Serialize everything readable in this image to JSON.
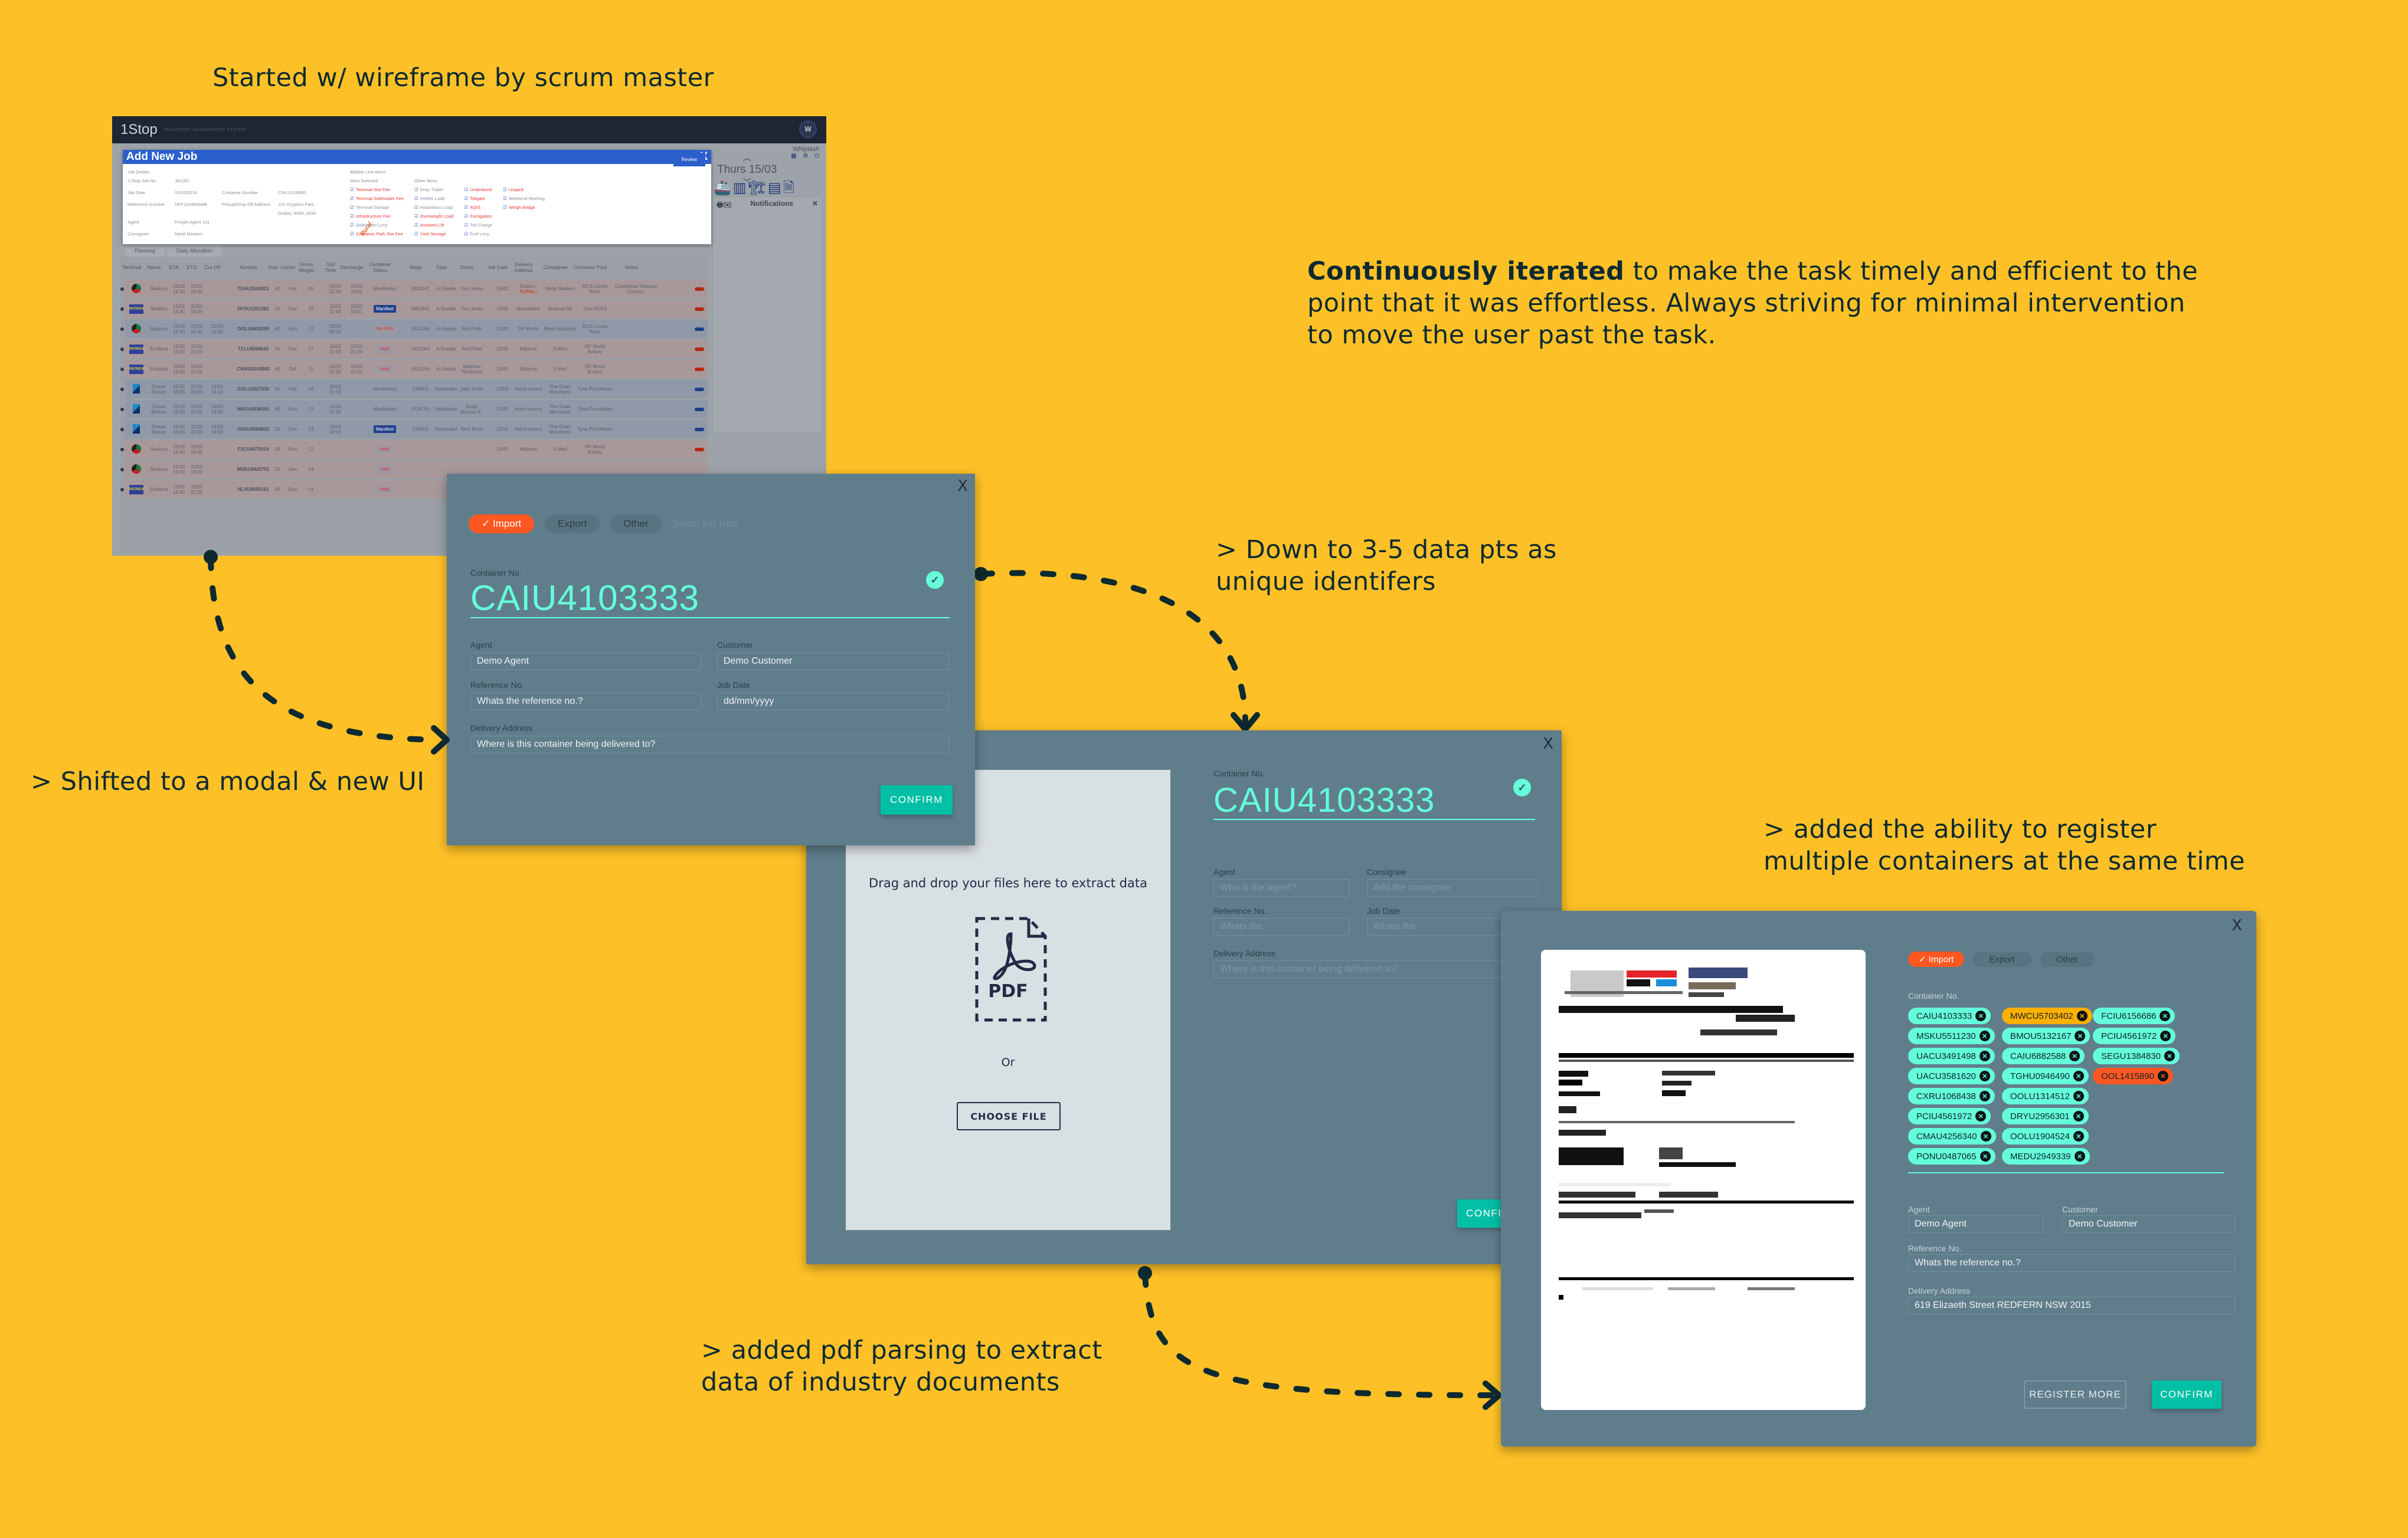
{
  "annotations": {
    "wireframe_caption": "Started w/ wireframe by scrum master",
    "iterated_bold": "Continuously iterated",
    "iterated_rest_1": " to make the task timely and efficient to the",
    "iterated_rest_2": "point that it was effortless. Always striving for minimal intervention",
    "iterated_rest_3": "to move the user past the task.",
    "modal_caption": "> Shifted to a modal & new UI",
    "data_pts_1": "> Down to 3-5 data pts as",
    "data_pts_2": "unique identifers",
    "pdf_1": "> added pdf parsing to extract",
    "pdf_2": "data of industry documents",
    "multi_1": "> added the ability to register",
    "multi_2": "multiple containers at the same time"
  },
  "wireframe": {
    "app_name": "1Stop",
    "app_subtitle": "TRANSPORT MANAGEMENT SYSTEM",
    "avatar_initial": "W",
    "user_name": "Whiplash",
    "user_icons": "▦ ⚙ ⏻",
    "date": "Thurs 15/03",
    "quick_icons": "🚢▥🏗▤🗎",
    "notifications_title": "Notifications",
    "notifications_icons": "🖶✉",
    "modal": {
      "title": "Add New Job",
      "close": "X",
      "job_details": "Job Details",
      "rows": [
        {
          "label": "1-Stop Job No",
          "value": "JB1001"
        },
        {
          "label": "Job Date",
          "value": "01/05/2018",
          "label2": "Container Number",
          "value2": "CNIU1216890"
        },
        {
          "label": "Reference Number",
          "value": "REF123456ABB",
          "label2": "Pickup/Drop Off Address",
          "value2": "101 Gryphon Park, Dubbo, NSW, 2830"
        },
        {
          "label": "Agent",
          "value": "Freight Agent 101"
        },
        {
          "label": "Consignee",
          "value": "Metal Masters"
        }
      ],
      "rural_stamp": "Rural",
      "billable_title": "Billable Line Items",
      "most_selected_title": "Most Selected",
      "other_items_title": "Other Items",
      "most_selected": [
        {
          "label": "Terminal Slot Fee",
          "red": true
        },
        {
          "label": "Terminal Sideloader Fee",
          "red": true
        },
        {
          "label": "Terminal Storage",
          "red": false
        },
        {
          "label": "Infrastructure Fee",
          "red": true
        },
        {
          "label": "Sideloader Levy",
          "red": false
        },
        {
          "label": "Container Park Slot Fee",
          "red": true
        }
      ],
      "other_col1": [
        {
          "label": "Drop Trailer",
          "red": false
        },
        {
          "label": "Reefer Load",
          "red": false
        },
        {
          "label": "Hazardous Load",
          "red": false
        },
        {
          "label": "Overweight Load",
          "red": true
        },
        {
          "label": "Assisted Lift",
          "red": true
        },
        {
          "label": "Yard Storage",
          "red": true
        }
      ],
      "other_col2": [
        {
          "label": "Underbond",
          "red": true
        },
        {
          "label": "Tailgate",
          "red": true
        },
        {
          "label": "AQIS",
          "red": true
        },
        {
          "label": "Fumigation",
          "red": true
        },
        {
          "label": "Toll Charge",
          "red": false
        },
        {
          "label": "Fuel Levy",
          "red": false
        }
      ],
      "other_col3": [
        {
          "label": "Unpack",
          "red": true
        },
        {
          "label": "Weekend Working",
          "red": false
        },
        {
          "label": "Weigh Bridge",
          "red": true
        }
      ],
      "review_label": "Review"
    },
    "tabs": [
      "Planning",
      "Daily Allocation"
    ],
    "columns": [
      "Terminal",
      "Name",
      "ETA",
      "ETD",
      "Cut Off",
      "Number",
      "Size",
      "Comm",
      "Gross Weight",
      "Slot Time",
      "Discharge",
      "Container Status",
      "Rego",
      "Type",
      "Driver",
      "Job Date",
      "Delivery Address",
      "Consignee",
      "Container Park",
      "Notes"
    ],
    "rows": [
      {
        "tone": "red",
        "terminal": "dp",
        "name": "Seabury",
        "eta": "15/03 14:30",
        "etd": "22/03 18:00",
        "cutoff": "",
        "number": "TGHU3543821",
        "size": "40",
        "comm": "Haz",
        "weight": "25",
        "slot": "15/03 22:00",
        "discharge": "15/03 18:01",
        "status": "Manifested",
        "status_type": "text",
        "rego": "BB10HC",
        "type": "A-Double",
        "driver": "Tom Jones",
        "jobdate": "15/03",
        "delivery": "Dubbo / RURAL!",
        "consignee": "Metal Masters",
        "park": "MCS Cooks River",
        "notes": "Conditional Release! Contact..",
        "pill": "red"
      },
      {
        "tone": "red",
        "terminal": "pat",
        "name": "Seabury",
        "eta": "15/03 14:30",
        "etd": "22/03 18:00",
        "cutoff": "",
        "number": "DFSU1201282",
        "size": "20",
        "comm": "Haz",
        "weight": "25",
        "slot": "15/03 22:00",
        "discharge": "15/03 18:01",
        "status": "Manifest",
        "status_type": "manifest",
        "rego": "BB10HC",
        "type": "A-Double",
        "driver": "Tom Jones",
        "jobdate": "15/03",
        "delivery": "Moorebank",
        "consignee": "Musical Hifi",
        "park": "Tyne ACFS",
        "notes": "",
        "pill": "red"
      },
      {
        "tone": "blue",
        "terminal": "dp",
        "name": "Seabury",
        "eta": "15/03 14:30",
        "etd": "22/03 14:30",
        "cutoff": "22/03 11:00",
        "number": "OOLU6439390",
        "size": "40",
        "comm": "Gen",
        "weight": "12",
        "slot": "22/03 09:00",
        "discharge": "",
        "status": "No PRA",
        "status_type": "held",
        "rego": "HG10AA",
        "type": "A-Double",
        "driver": "Anit Patel",
        "jobdate": "15/03",
        "delivery": "DP World",
        "consignee": "Meat Industries",
        "park": "MCS Cooks River",
        "notes": "",
        "pill": "blue"
      },
      {
        "tone": "red",
        "terminal": "pat",
        "name": "Scotland",
        "eta": "15/03 18:00",
        "etd": "22/03 22:00",
        "cutoff": "",
        "number": "TCLU8068643",
        "size": "40",
        "comm": "Haz",
        "weight": "27",
        "slot": "15/03 21:00",
        "discharge": "15/03 21:04",
        "status": "Held",
        "status_type": "held",
        "rego": "HG10AA",
        "type": "A-Double",
        "driver": "Anit Patel",
        "jobdate": "15/03",
        "delivery": "Milperra",
        "consignee": "S-Mart",
        "park": "DP World Botany",
        "notes": "",
        "pill": "red"
      },
      {
        "tone": "red",
        "terminal": "pat",
        "name": "Scotland",
        "eta": "15/03 18:00",
        "etd": "22/03 22:00",
        "cutoff": "",
        "number": "CMAU0243860",
        "size": "40",
        "comm": "Ref",
        "weight": "11",
        "slot": "15/03 21:00",
        "discharge": "15/03 21:22",
        "status": "Held",
        "status_type": "held",
        "rego": "HG10AA",
        "type": "A-Double",
        "driver": "Matthew Tomlinson",
        "jobdate": "15/03",
        "delivery": "Milperra",
        "consignee": "S-Mart",
        "park": "DP World Botany",
        "notes": "",
        "pill": "red"
      },
      {
        "tone": "blue",
        "terminal": "ob",
        "name": "Ocean Breeze",
        "eta": "15/03 18:00",
        "etd": "22/03 22:00",
        "cutoff": "18/03 14:00",
        "number": "OOLU2927530",
        "size": "40",
        "comm": "Haz",
        "weight": "26",
        "slot": "15/03 21:00",
        "discharge": "",
        "status": "Manifested",
        "status_type": "text",
        "rego": "JJ44FG",
        "type": "Sideloader",
        "driver": "Jake Smith",
        "jobdate": "15/03",
        "delivery": "Hutch-insons",
        "consignee": "The Grain Merchants",
        "park": "Tyne Punchbowl",
        "notes": "",
        "pill": "blue"
      },
      {
        "tone": "blue",
        "terminal": "ob",
        "name": "Ocean Breeze",
        "eta": "15/03 18:00",
        "etd": "22/03 22:00",
        "cutoff": "18/03 14:00",
        "number": "MAEU4036061",
        "size": "40",
        "comm": "Gen",
        "weight": "13",
        "slot": "15/03 21:00",
        "discharge": "",
        "status": "Manifested",
        "status_type": "text",
        "rego": "PO87AS",
        "type": "Sideloader",
        "driver": "Balaji Mannar K..",
        "jobdate": "15/03",
        "delivery": "Hutch-insons",
        "consignee": "The Grain Merchants",
        "park": "Tyne Punchbowl",
        "notes": "",
        "pill": "blue"
      },
      {
        "tone": "blue",
        "terminal": "ob",
        "name": "Ocean Breeze",
        "eta": "15/03 18:00",
        "etd": "22/03 22:00",
        "cutoff": "18/03 14:00",
        "number": "HASU4284832",
        "size": "20",
        "comm": "Gen",
        "weight": "13",
        "slot": "15/03 18:00",
        "discharge": "",
        "status": "Manifest",
        "status_type": "manifest",
        "rego": "JJ44FG",
        "type": "Sideloader",
        "driver": "Kent Rose",
        "jobdate": "15/03",
        "delivery": "Hutch-insons",
        "consignee": "The Grain Merchants",
        "park": "Tyne Punchbowl",
        "notes": "",
        "pill": "blue"
      },
      {
        "tone": "red",
        "terminal": "dp",
        "name": "Seabury",
        "eta": "15/03 14:30",
        "etd": "22/03 18:00",
        "cutoff": "",
        "number": "FSCU6875014",
        "size": "20",
        "comm": "Gen",
        "weight": "12",
        "slot": "",
        "discharge": "",
        "status": "Held",
        "status_type": "held",
        "rego": "",
        "type": "",
        "driver": "",
        "jobdate": "15/03",
        "delivery": "Milperra",
        "consignee": "S-Mart",
        "park": "DP World Botany",
        "notes": "",
        "pill": "red"
      },
      {
        "tone": "red",
        "terminal": "dp",
        "name": "Seabury",
        "eta": "15/03 14:30",
        "etd": "22/03 18:00",
        "cutoff": "",
        "number": "MSKU8420751",
        "size": "20",
        "comm": "Gen",
        "weight": "14",
        "slot": "",
        "discharge": "",
        "status": "Held",
        "status_type": "held",
        "rego": "",
        "type": "",
        "driver": "",
        "jobdate": "",
        "delivery": "",
        "consignee": "",
        "park": "",
        "notes": "",
        "pill": ""
      },
      {
        "tone": "red",
        "terminal": "pat",
        "name": "Scotland",
        "eta": "15/03 18:00",
        "etd": "22/03 22:00",
        "cutoff": "",
        "number": "HLXU8085161",
        "size": "20",
        "comm": "Gen",
        "weight": "14",
        "slot": "",
        "discharge": "",
        "status": "Held",
        "status_type": "held",
        "rego": "",
        "type": "",
        "driver": "",
        "jobdate": "",
        "delivery": "",
        "consignee": "",
        "park": "",
        "notes": "",
        "pill": ""
      }
    ]
  },
  "modal1": {
    "close": "X",
    "job_types": [
      "Import",
      "Export",
      "Other"
    ],
    "active_job_type": "Import",
    "job_type_hint": "Select job type",
    "container_label": "Container No.",
    "container_value": "CAIU4103333",
    "agent_label": "Agent",
    "agent_value": "Demo Agent",
    "customer_label": "Customer",
    "customer_value": "Demo Customer",
    "reference_label": "Reference No.",
    "reference_placeholder": "Whats the reference no.?",
    "jobdate_label": "Job Date",
    "jobdate_placeholder": "dd/mm/yyyy",
    "delivery_label": "Delivery Address",
    "delivery_placeholder": "Where is this container being delivered to?",
    "confirm_label": "CONFIRM"
  },
  "modal2": {
    "close": "X",
    "drop_title": "Drag and drop your files here to extract data",
    "pdf_label": "PDF",
    "or_label": "Or",
    "choose_file_label": "CHOOSE FILE",
    "container_label": "Container No.",
    "container_value": "CAIU4103333",
    "agent_label": "Agent",
    "agent_placeholder": "Who is the agent?",
    "consignee_label": "Consignee",
    "consignee_placeholder": "Add the consignee",
    "reference_label": "Reference No.",
    "reference_placeholder": "Whats the",
    "jobdate_label": "Job Date",
    "jobdate_placeholder": "Whats the",
    "delivery_label": "Delivery Address",
    "delivery_placeholder": "Where is this container being delivered to?",
    "confirm_label": "CONFIRM"
  },
  "modal3": {
    "close": "X",
    "job_types": [
      "Import",
      "Export",
      "Other"
    ],
    "active_job_type": "Import",
    "container_label": "Container No.",
    "containers": [
      {
        "id": "CAIU4103333",
        "status": "ok"
      },
      {
        "id": "MSKU5511230",
        "status": "ok"
      },
      {
        "id": "UACU3491498",
        "status": "ok"
      },
      {
        "id": "UACU3581620",
        "status": "ok"
      },
      {
        "id": "CXRU1068438",
        "status": "ok"
      },
      {
        "id": "PCIU4561972",
        "status": "ok"
      },
      {
        "id": "CMAU4256340",
        "status": "ok"
      },
      {
        "id": "PONU0487065",
        "status": "ok"
      },
      {
        "id": "MWCU5703402",
        "status": "warning"
      },
      {
        "id": "BMOU5132167",
        "status": "ok"
      },
      {
        "id": "CAIU6882588",
        "status": "ok"
      },
      {
        "id": "TGHU0946490",
        "status": "ok"
      },
      {
        "id": "OOLU1314512",
        "status": "ok"
      },
      {
        "id": "DRYU2956301",
        "status": "ok"
      },
      {
        "id": "OOLU1904524",
        "status": "ok"
      },
      {
        "id": "MEDU2949339",
        "status": "ok"
      },
      {
        "id": "FCIU6156686",
        "status": "ok"
      },
      {
        "id": "PCIU4561972",
        "status": "ok"
      },
      {
        "id": "SEGU1384830",
        "status": "ok"
      },
      {
        "id": "OOL1415890",
        "status": "error"
      }
    ],
    "agent_label": "Agent",
    "agent_value": "Demo Agent",
    "customer_label": "Customer",
    "customer_value": "Demo Customer",
    "reference_label": "Reference No.",
    "reference_placeholder": "Whats the reference no.?",
    "delivery_label": "Delivery Address",
    "delivery_value": "619 Elizaeth Street REDFERN NSW 2015",
    "register_more_label": "REGISTER MORE",
    "confirm_label": "CONFIRM"
  },
  "colors": {
    "background": "#FDC127",
    "modal": "#607D8B",
    "accent_teal": "#64FFDA",
    "confirm": "#00BFA5",
    "import_active": "#FF5722",
    "warning_tag": "#FFB000",
    "error_tag": "#FF5722",
    "wireframe_header": "#2B5FCB"
  }
}
